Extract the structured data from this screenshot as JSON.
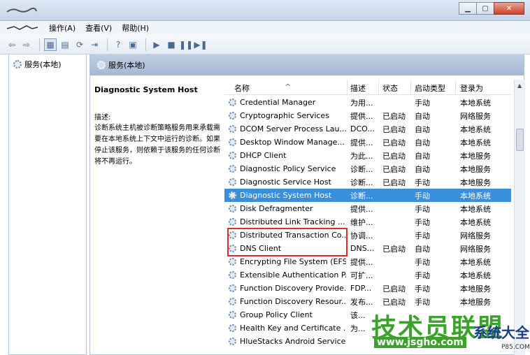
{
  "menu": {
    "items": [
      "操作(A)",
      "查看(V)",
      "帮助(H)"
    ]
  },
  "tree": {
    "item": "服务(本地)"
  },
  "main": {
    "header": "服务(本地)"
  },
  "details": {
    "title": "Diagnostic System Host",
    "label": "描述:",
    "text": "诊断系统主机被诊断策略服务用来承载需要在本地系统上下文中运行的诊断。如果停止该服务，则依赖于该服务的任何诊断将不再运行。"
  },
  "columns": {
    "name": "名称",
    "description": "描述",
    "status": "状态",
    "startup": "启动类型",
    "logon": "登录为"
  },
  "services": [
    {
      "name": "Credential Manager",
      "desc": "为用...",
      "status": "",
      "start": "手动",
      "logon": "本地系统"
    },
    {
      "name": "Cryptographic Services",
      "desc": "提供...",
      "status": "已启动",
      "start": "自动",
      "logon": "网络服务"
    },
    {
      "name": "DCOM Server Process Lau...",
      "desc": "DCO...",
      "status": "已启动",
      "start": "自动",
      "logon": "本地系统"
    },
    {
      "name": "Desktop Window Manage...",
      "desc": "提供...",
      "status": "已启动",
      "start": "自动",
      "logon": "本地系统"
    },
    {
      "name": "DHCP Client",
      "desc": "为此...",
      "status": "已启动",
      "start": "自动",
      "logon": "本地服务"
    },
    {
      "name": "Diagnostic Policy Service",
      "desc": "诊断...",
      "status": "已启动",
      "start": "自动",
      "logon": "本地服务"
    },
    {
      "name": "Diagnostic Service Host",
      "desc": "诊断...",
      "status": "已启动",
      "start": "手动",
      "logon": "本地服务"
    },
    {
      "name": "Diagnostic System Host",
      "desc": "诊断...",
      "status": "",
      "start": "手动",
      "logon": "本地系统"
    },
    {
      "name": "Disk Defragmenter",
      "desc": "提供...",
      "status": "",
      "start": "手动",
      "logon": "本地系统"
    },
    {
      "name": "Distributed Link Tracking ...",
      "desc": "维护...",
      "status": "",
      "start": "手动",
      "logon": "本地系统"
    },
    {
      "name": "Distributed Transaction Co...",
      "desc": "协调...",
      "status": "",
      "start": "手动",
      "logon": "网络服务"
    },
    {
      "name": "DNS Client",
      "desc": "DNS...",
      "status": "已启动",
      "start": "自动",
      "logon": "网络服务"
    },
    {
      "name": "Encrypting File System (EFS)",
      "desc": "提供...",
      "status": "",
      "start": "手动",
      "logon": "本地系统"
    },
    {
      "name": "Extensible Authentication P...",
      "desc": "可扩...",
      "status": "",
      "start": "手动",
      "logon": "本地系统"
    },
    {
      "name": "Function Discovery Provide...",
      "desc": "FDP...",
      "status": "已启动",
      "start": "手动",
      "logon": "本地服务"
    },
    {
      "name": "Function Discovery Resour...",
      "desc": "发布...",
      "status": "已启动",
      "start": "手动",
      "logon": "本地服务"
    },
    {
      "name": "Group Policy Client",
      "desc": "该...",
      "status": "",
      "start": "",
      "logon": ""
    },
    {
      "name": "Health Key and Certificate ...",
      "desc": "为...",
      "status": "",
      "start": "",
      "logon": ""
    },
    {
      "name": "HlueStacks Android Service",
      "desc": "",
      "status": "",
      "start": "",
      "logon": ""
    }
  ],
  "selected_index": 7,
  "watermark": {
    "brand": "技术员联盟",
    "url": "www.jsgho.com",
    "side": "系统大全",
    "small": "P85.COM"
  }
}
